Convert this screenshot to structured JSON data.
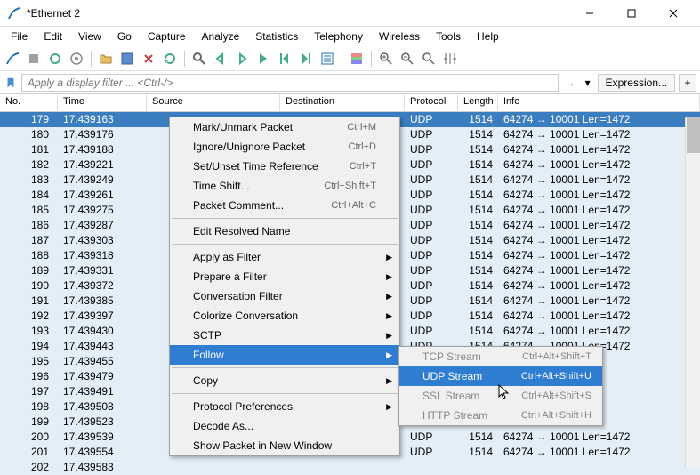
{
  "title": "*Ethernet 2",
  "menus": [
    "File",
    "Edit",
    "View",
    "Go",
    "Capture",
    "Analyze",
    "Statistics",
    "Telephony",
    "Wireless",
    "Tools",
    "Help"
  ],
  "filter_placeholder": "Apply a display filter ... <Ctrl-/>",
  "expression_label": "Expression...",
  "plus_label": "+",
  "columns": {
    "no": "No.",
    "time": "Time",
    "src": "Source",
    "dst": "Destination",
    "proto": "Protocol",
    "len": "Length",
    "info": "Info"
  },
  "packets": [
    {
      "no": "179",
      "time": "17.439163",
      "proto": "UDP",
      "len": "1514",
      "info": "64274 → 10001 Len=1472",
      "sel": true
    },
    {
      "no": "180",
      "time": "17.439176",
      "proto": "UDP",
      "len": "1514",
      "info": "64274 → 10001 Len=1472"
    },
    {
      "no": "181",
      "time": "17.439188",
      "proto": "UDP",
      "len": "1514",
      "info": "64274 → 10001 Len=1472"
    },
    {
      "no": "182",
      "time": "17.439221",
      "proto": "UDP",
      "len": "1514",
      "info": "64274 → 10001 Len=1472"
    },
    {
      "no": "183",
      "time": "17.439249",
      "proto": "UDP",
      "len": "1514",
      "info": "64274 → 10001 Len=1472"
    },
    {
      "no": "184",
      "time": "17.439261",
      "proto": "UDP",
      "len": "1514",
      "info": "64274 → 10001 Len=1472"
    },
    {
      "no": "185",
      "time": "17.439275",
      "proto": "UDP",
      "len": "1514",
      "info": "64274 → 10001 Len=1472"
    },
    {
      "no": "186",
      "time": "17.439287",
      "proto": "UDP",
      "len": "1514",
      "info": "64274 → 10001 Len=1472"
    },
    {
      "no": "187",
      "time": "17.439303",
      "proto": "UDP",
      "len": "1514",
      "info": "64274 → 10001 Len=1472"
    },
    {
      "no": "188",
      "time": "17.439318",
      "proto": "UDP",
      "len": "1514",
      "info": "64274 → 10001 Len=1472"
    },
    {
      "no": "189",
      "time": "17.439331",
      "proto": "UDP",
      "len": "1514",
      "info": "64274 → 10001 Len=1472"
    },
    {
      "no": "190",
      "time": "17.439372",
      "proto": "UDP",
      "len": "1514",
      "info": "64274 → 10001 Len=1472"
    },
    {
      "no": "191",
      "time": "17.439385",
      "proto": "UDP",
      "len": "1514",
      "info": "64274 → 10001 Len=1472"
    },
    {
      "no": "192",
      "time": "17.439397",
      "proto": "UDP",
      "len": "1514",
      "info": "64274 → 10001 Len=1472"
    },
    {
      "no": "193",
      "time": "17.439430",
      "proto": "UDP",
      "len": "1514",
      "info": "64274 → 10001 Len=1472"
    },
    {
      "no": "194",
      "time": "17.439443",
      "proto": "UDP",
      "len": "1514",
      "info": "64274 → 10001 Len=1472"
    },
    {
      "no": "195",
      "time": "17.439455",
      "proto": "",
      "len": "",
      "info": "1472"
    },
    {
      "no": "196",
      "time": "17.439479",
      "proto": "",
      "len": "",
      "info": "1472"
    },
    {
      "no": "197",
      "time": "17.439491",
      "proto": "",
      "len": "",
      "info": "1472"
    },
    {
      "no": "198",
      "time": "17.439508",
      "proto": "",
      "len": "",
      "info": "1472"
    },
    {
      "no": "199",
      "time": "17.439523",
      "proto": "",
      "len": "",
      "info": "1472"
    },
    {
      "no": "200",
      "time": "17.439539",
      "proto": "UDP",
      "len": "1514",
      "info": "64274 → 10001 Len=1472"
    },
    {
      "no": "201",
      "time": "17.439554",
      "proto": "UDP",
      "len": "1514",
      "info": "64274 → 10001 Len=1472"
    },
    {
      "no": "202",
      "time": "17.439583",
      "proto": "",
      "len": "",
      "info": ""
    }
  ],
  "context_menu": [
    {
      "type": "item",
      "label": "Mark/Unmark Packet",
      "shortcut": "Ctrl+M"
    },
    {
      "type": "item",
      "label": "Ignore/Unignore Packet",
      "shortcut": "Ctrl+D"
    },
    {
      "type": "item",
      "label": "Set/Unset Time Reference",
      "shortcut": "Ctrl+T"
    },
    {
      "type": "item",
      "label": "Time Shift...",
      "shortcut": "Ctrl+Shift+T"
    },
    {
      "type": "item",
      "label": "Packet Comment...",
      "shortcut": "Ctrl+Alt+C"
    },
    {
      "type": "sep"
    },
    {
      "type": "item",
      "label": "Edit Resolved Name"
    },
    {
      "type": "sep"
    },
    {
      "type": "sub",
      "label": "Apply as Filter"
    },
    {
      "type": "sub",
      "label": "Prepare a Filter"
    },
    {
      "type": "sub",
      "label": "Conversation Filter"
    },
    {
      "type": "sub",
      "label": "Colorize Conversation"
    },
    {
      "type": "sub",
      "label": "SCTP"
    },
    {
      "type": "sub",
      "label": "Follow",
      "hl": true
    },
    {
      "type": "sep"
    },
    {
      "type": "sub",
      "label": "Copy"
    },
    {
      "type": "sep"
    },
    {
      "type": "sub",
      "label": "Protocol Preferences"
    },
    {
      "type": "item",
      "label": "Decode As..."
    },
    {
      "type": "item",
      "label": "Show Packet in New Window"
    }
  ],
  "submenu": [
    {
      "label": "TCP Stream",
      "shortcut": "Ctrl+Alt+Shift+T",
      "disabled": true
    },
    {
      "label": "UDP Stream",
      "shortcut": "Ctrl+Alt+Shift+U",
      "hl": true
    },
    {
      "label": "SSL Stream",
      "shortcut": "Ctrl+Alt+Shift+S",
      "disabled": true
    },
    {
      "label": "HTTP Stream",
      "shortcut": "Ctrl+Alt+Shift+H",
      "disabled": true
    }
  ]
}
